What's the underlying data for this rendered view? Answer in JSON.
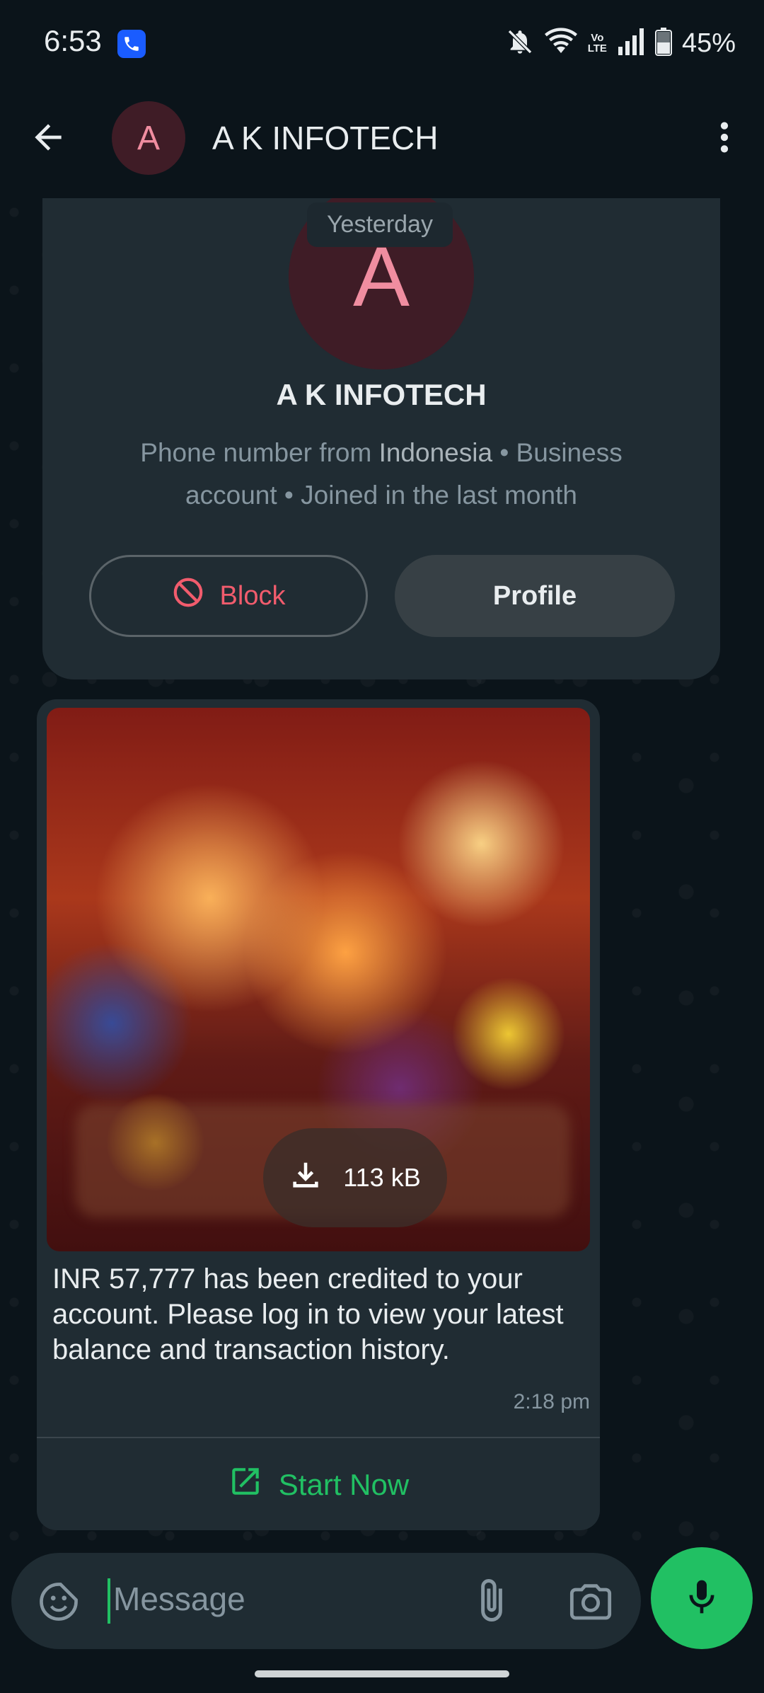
{
  "status_bar": {
    "time": "6:53",
    "battery_percent": "45%",
    "volte_top": "Vo",
    "volte_bottom": "LTE",
    "icons": [
      "phone-app-icon",
      "mute-bell-icon",
      "wifi-icon",
      "volte-icon",
      "signal-icon",
      "battery-icon"
    ]
  },
  "header": {
    "avatar_letter": "A",
    "contact_name": "A K INFOTECH"
  },
  "chat": {
    "date_chip": "Yesterday",
    "contact_card": {
      "avatar_letter": "A",
      "name": "A K INFOTECH",
      "desc_prefix": "Phone number from ",
      "desc_country": "Indonesia",
      "desc_suffix": " • Business account • Joined in the last month",
      "block_label": "Block",
      "profile_label": "Profile"
    },
    "message": {
      "media_size": "113 kB",
      "text": "INR 57,777 has been credited to your account. Please log in to view your latest balance and transaction history.",
      "time": "2:18 pm",
      "action_label": "Start Now"
    }
  },
  "composer": {
    "placeholder": "Message"
  },
  "colors": {
    "background": "#0b141a",
    "bubble": "#202c33",
    "accent_green": "#21c063",
    "block_red": "#f15c6d",
    "avatar_bg": "#3f1c26",
    "avatar_letter": "#f08da0"
  }
}
